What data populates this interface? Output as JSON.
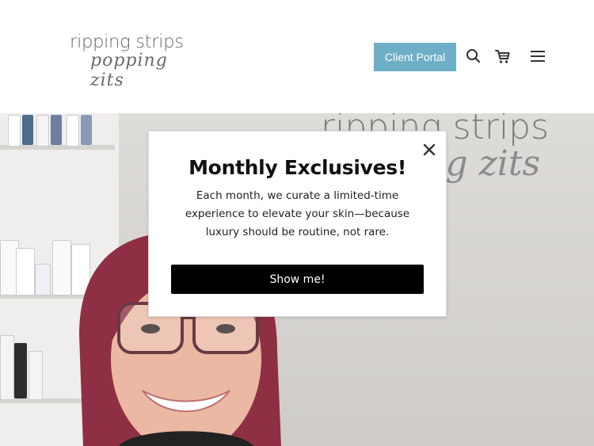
{
  "header": {
    "logo": {
      "line1": "ripping strips",
      "line2": "popping zits"
    },
    "client_portal_label": "Client Portal",
    "icons": [
      "search-icon",
      "cart-icon",
      "menu-icon"
    ]
  },
  "hero": {
    "wall_sign_line1": "ripping strips",
    "wall_sign_line2": "ing zits"
  },
  "modal": {
    "title": "Monthly Exclusives!",
    "body_lines": [
      "Each month, we curate a limited-time",
      "experience to elevate your skin—because",
      "luxury should be routine, not rare."
    ],
    "cta_label": "Show me!",
    "close_icon": "close-icon"
  },
  "colors": {
    "accent": "#6eafc7",
    "cta_background": "#000000",
    "logo_text": "#6a6a6a",
    "hair": "#8e2f44"
  }
}
